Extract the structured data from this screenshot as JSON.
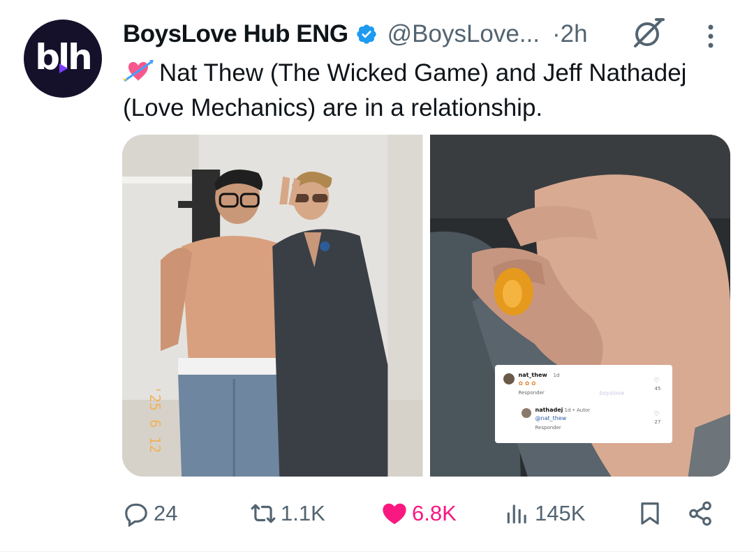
{
  "author": {
    "avatar_text": "blh",
    "display_name": "BoysLove Hub ENG",
    "handle": "@BoysLove...",
    "time": "·2h"
  },
  "tweet": {
    "emoji": "heart-with-arrow-emoji",
    "text": "Nat Thew (The Wicked Game) and Jeff Nathadej (Love Mechanics) are in a relationship."
  },
  "media": {
    "photo_left_stamp": "'25 6 12",
    "overlay_comment": {
      "user1": "nat_thew",
      "user1_time": "1d",
      "reply_label1": "Responder",
      "likes1": "45",
      "watermark": "boyslove",
      "user2": "nathadej",
      "user2_time": "1d • Autor",
      "mention": "@nat_thew",
      "reply_label2": "Responder",
      "likes2": "27"
    }
  },
  "actions": {
    "replies": "24",
    "reposts": "1.1K",
    "likes": "6.8K",
    "views": "145K"
  },
  "colors": {
    "like": "#f91880",
    "muted": "#536471",
    "verified": "#1d9bf0"
  }
}
